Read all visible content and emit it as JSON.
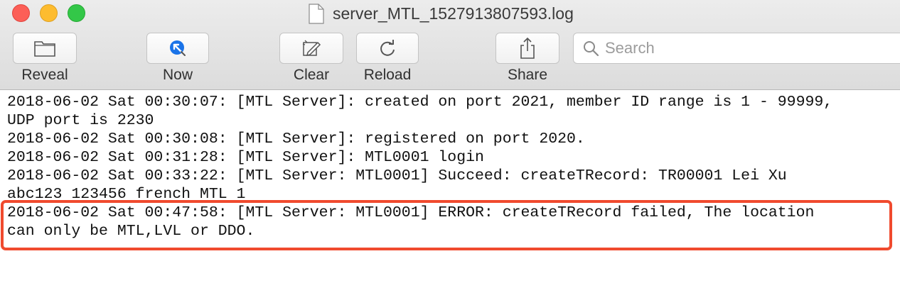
{
  "window": {
    "title": "server_MTL_1527913807593.log"
  },
  "toolbar": {
    "reveal_label": "Reveal",
    "now_label": "Now",
    "clear_label": "Clear",
    "reload_label": "Reload",
    "share_label": "Share",
    "search_placeholder": "Search"
  },
  "log": {
    "lines": [
      "2018-06-02 Sat 00:30:07: [MTL Server]: created on port 2021, member ID range is 1 - 99999,",
      "UDP port is 2230",
      "2018-06-02 Sat 00:30:08: [MTL Server]: registered on port 2020.",
      "2018-06-02 Sat 00:31:28: [MTL Server]: MTL0001 login",
      "2018-06-02 Sat 00:33:22: [MTL Server: MTL0001] Succeed: createTRecord: TR00001 Lei Xu",
      "abc123 123456 french MTL 1",
      "2018-06-02 Sat 00:47:58: [MTL Server: MTL0001] ERROR: createTRecord failed, The location",
      "can only be MTL,LVL or DDO."
    ]
  },
  "colors": {
    "highlight_border": "#f04a2e",
    "now_icon": "#1a73e8"
  }
}
